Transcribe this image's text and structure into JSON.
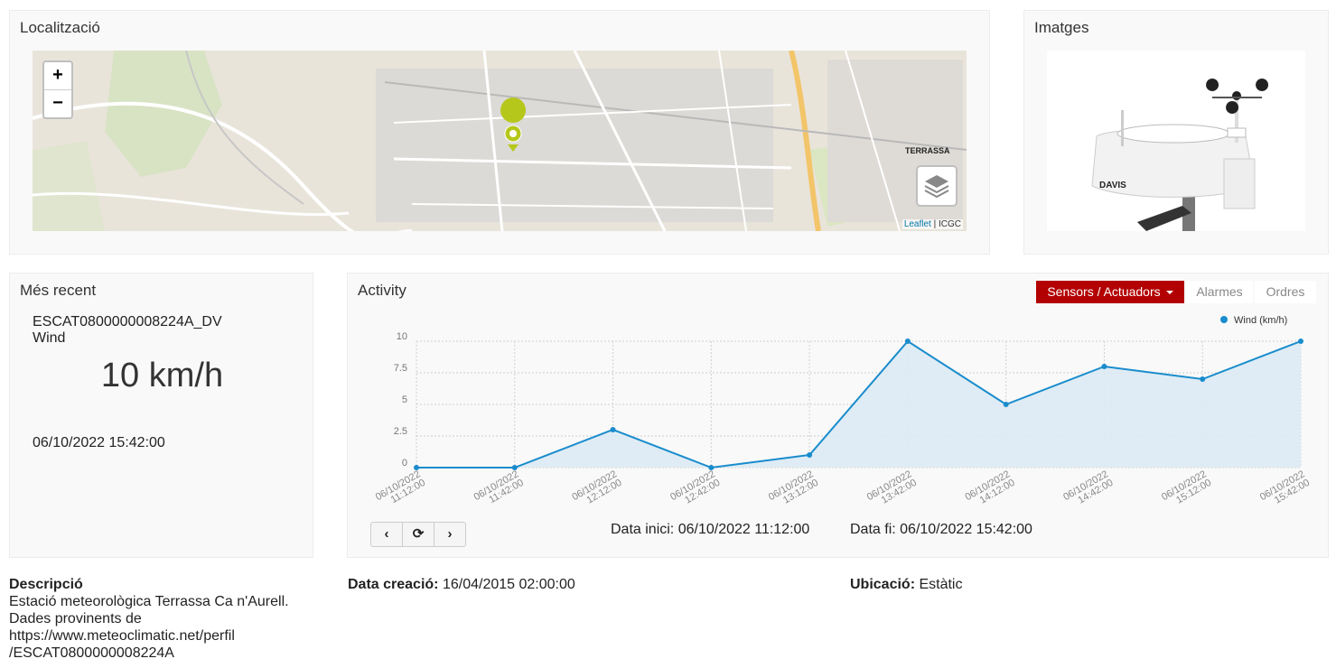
{
  "location": {
    "title": "Localització",
    "zoom_in": "+",
    "zoom_out": "−",
    "map_label": "TERRASSA",
    "attribution_link": "Leaflet",
    "attribution_sep": " | ",
    "attribution_text": "ICGC"
  },
  "images": {
    "title": "Imatges",
    "brand": "DAVIS"
  },
  "recent": {
    "title": "Més recent",
    "sensor_id": "ESCAT0800000008224A_DV",
    "variable": "Wind",
    "value": "10 km/h",
    "date": "06/10/2022 15:42:00"
  },
  "activity": {
    "title": "Activity",
    "sensors_button": "Sensors / Actuadors",
    "tab_alarms": "Alarmes",
    "tab_orders": "Ordres",
    "range_start_label": "Data inici:",
    "range_start": "06/10/2022 11:12:00",
    "range_end_label": "Data fi:",
    "range_end": "06/10/2022 15:42:00",
    "nav_prev": "‹",
    "nav_refresh": "⟳",
    "nav_next": "›",
    "colors": {
      "line": "#1a8ccc",
      "fill": "#dbeaf4",
      "accent": "#b30000"
    }
  },
  "chart_data": {
    "type": "area",
    "x": [
      "06/10/2022 11:12:00",
      "06/10/2022 11:42:00",
      "06/10/2022 12:12:00",
      "06/10/2022 12:42:00",
      "06/10/2022 13:12:00",
      "06/10/2022 13:42:00",
      "06/10/2022 14:12:00",
      "06/10/2022 14:42:00",
      "06/10/2022 15:12:00",
      "06/10/2022 15:42:00"
    ],
    "series": [
      {
        "name": "Wind (km/h)",
        "values": [
          0,
          0,
          3,
          0,
          1,
          10,
          5,
          8,
          7,
          10
        ]
      }
    ],
    "yticks": [
      "0",
      "2.5",
      "5",
      "7.5",
      "10"
    ],
    "ylim": [
      0,
      10
    ],
    "grid": true,
    "legend": "top-right"
  },
  "description": {
    "desc_label": "Descripció",
    "desc_lines": [
      "Estació meteorològica Terrassa Ca n'Aurell.",
      "Dades provinents de",
      "https://www.meteoclimatic.net/perfil",
      "/ESCAT0800000008224A"
    ],
    "created_label": "Data creació:",
    "created_value": "16/04/2015 02:00:00",
    "location_label": "Ubicació:",
    "location_value": "Estàtic"
  }
}
